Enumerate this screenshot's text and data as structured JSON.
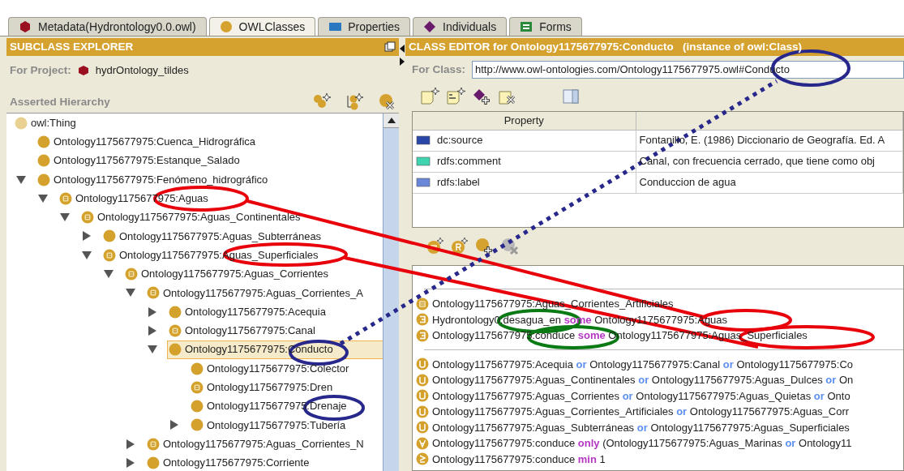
{
  "tabs": [
    {
      "label": "Metadata(Hydrontology0.0.owl)",
      "kind": "metadata",
      "selected": false
    },
    {
      "label": "OWLClasses",
      "kind": "classes",
      "selected": true
    },
    {
      "label": "Properties",
      "kind": "properties",
      "selected": false
    },
    {
      "label": "Individuals",
      "kind": "individuals",
      "selected": false
    },
    {
      "label": "Forms",
      "kind": "forms",
      "selected": false
    }
  ],
  "subclass_explorer": {
    "title": "SUBCLASS EXPLORER",
    "project_label": "For Project:",
    "project": "hydrOntology_tildes",
    "hierarchy_label": "Asserted Hierarchy",
    "tree": [
      {
        "label": "owl:Thing",
        "kind": "thing",
        "selected": false,
        "children": [
          {
            "label": "Ontology1175677975:Cuenca_Hidrográfica",
            "kind": "primitive",
            "selected": false
          },
          {
            "label": "Ontology1175677975:Estanque_Salado",
            "kind": "primitive",
            "selected": false
          },
          {
            "label": "Ontology1175677975:Fenómeno_hidrográfico",
            "kind": "primitive",
            "selected": false,
            "expanded": true,
            "children": [
              {
                "label": "Ontology1175677975:Aguas",
                "kind": "defined",
                "selected": false,
                "expanded": true,
                "children": [
                  {
                    "label": "Ontology1175677975:Aguas_Continentales",
                    "kind": "defined",
                    "selected": false,
                    "expanded": true,
                    "children": [
                      {
                        "label": "Ontology1175677975:Aguas_Subterráneas",
                        "kind": "primitive",
                        "selected": false,
                        "expanded": false
                      },
                      {
                        "label": "Ontology1175677975:Aguas_Superficiales",
                        "kind": "defined",
                        "selected": false,
                        "expanded": true,
                        "children": [
                          {
                            "label": "Ontology1175677975:Aguas_Corrientes",
                            "kind": "defined",
                            "selected": false,
                            "expanded": true,
                            "children": [
                              {
                                "label": "Ontology1175677975:Aguas_Corrientes_A",
                                "kind": "defined",
                                "selected": false,
                                "expanded": true,
                                "children": [
                                  {
                                    "label": "Ontology1175677975:Acequia",
                                    "kind": "primitive",
                                    "selected": false,
                                    "expanded": false
                                  },
                                  {
                                    "label": "Ontology1175677975:Canal",
                                    "kind": "defined",
                                    "selected": false,
                                    "expanded": false
                                  },
                                  {
                                    "label": "Ontology1175677975:Conducto",
                                    "kind": "primitive",
                                    "selected": true,
                                    "expanded": true,
                                    "children": [
                                      {
                                        "label": "Ontology1175677975:Colector",
                                        "kind": "primitive",
                                        "selected": false
                                      },
                                      {
                                        "label": "Ontology1175677975:Dren",
                                        "kind": "defined",
                                        "selected": false
                                      },
                                      {
                                        "label": "Ontology1175677975:Drenaje",
                                        "kind": "primitive",
                                        "selected": false
                                      },
                                      {
                                        "label": "Ontology1175677975:Tubería",
                                        "kind": "primitive",
                                        "selected": false,
                                        "expanded": false
                                      }
                                    ]
                                  }
                                ]
                              },
                              {
                                "label": "Ontology1175677975:Aguas_Corrientes_N",
                                "kind": "defined",
                                "selected": false,
                                "expanded": false
                              },
                              {
                                "label": "Ontology1175677975:Corriente",
                                "kind": "primitive",
                                "selected": false,
                                "expanded": false
                              }
                            ]
                          }
                        ]
                      }
                    ]
                  }
                ]
              }
            ]
          }
        ]
      }
    ]
  },
  "class_editor": {
    "title": "CLASS EDITOR for Ontology1175677975:Conducto   (instance of owl:Class)",
    "class_label": "For Class:",
    "class_uri": "http://www.owl-ontologies.com/Ontology1175677975.owl#Conducto",
    "table": {
      "columns": [
        "Property"
      ],
      "rows": [
        {
          "property": "dc:source",
          "value": "Fontanillo, E. (1986) Diccionario de Geografía. Ed. A",
          "color": "#2a46a8"
        },
        {
          "property": "rdfs:comment",
          "value": "Canal, con frecuencia cerrado, que tiene como obj",
          "color": "#3fd4b0"
        },
        {
          "property": "rdfs:label",
          "value": "Conduccion de agua",
          "color": "#6a86d8"
        }
      ]
    },
    "condition_groups": [
      {
        "rows": [
          {
            "kind": "named",
            "parts": [
              {
                "text": "Ontology1175677975:Aguas_Corrientes_Artificiales",
                "kind": "term"
              }
            ]
          },
          {
            "kind": "some",
            "parts": [
              {
                "text": "Hydrontology0:desagua_en",
                "kind": "term"
              },
              {
                "text": "some",
                "kind": "quantifier"
              },
              {
                "text": "Ontology1175677975:Aguas",
                "kind": "term"
              }
            ]
          },
          {
            "kind": "some",
            "parts": [
              {
                "text": "Ontology1175677975:conduce",
                "kind": "term"
              },
              {
                "text": "some",
                "kind": "quantifier"
              },
              {
                "text": "Ontology1175677975:Aguas_Superficiales",
                "kind": "term"
              }
            ]
          }
        ]
      },
      {
        "rows": [
          {
            "kind": "union",
            "parts": [
              {
                "text": "Ontology1175677975:Acequia",
                "kind": "term"
              },
              {
                "text": "or",
                "kind": "connective"
              },
              {
                "text": "Ontology1175677975:Canal",
                "kind": "term"
              },
              {
                "text": "or",
                "kind": "connective"
              },
              {
                "text": "Ontology1175677975:Co",
                "kind": "term"
              }
            ]
          },
          {
            "kind": "union",
            "parts": [
              {
                "text": "Ontology1175677975:Aguas_Continentales",
                "kind": "term"
              },
              {
                "text": "or",
                "kind": "connective"
              },
              {
                "text": "Ontology1175677975:Aguas_Dulces",
                "kind": "term"
              },
              {
                "text": "or",
                "kind": "connective"
              },
              {
                "text": "On",
                "kind": "term"
              }
            ]
          },
          {
            "kind": "union",
            "parts": [
              {
                "text": "Ontology1175677975:Aguas_Corrientes",
                "kind": "term"
              },
              {
                "text": "or",
                "kind": "connective"
              },
              {
                "text": "Ontology1175677975:Aguas_Quietas",
                "kind": "term"
              },
              {
                "text": "or",
                "kind": "connective"
              },
              {
                "text": "Onto",
                "kind": "term"
              }
            ]
          },
          {
            "kind": "union",
            "parts": [
              {
                "text": "Ontology1175677975:Aguas_Corrientes_Artificiales",
                "kind": "term"
              },
              {
                "text": "or",
                "kind": "connective"
              },
              {
                "text": "Ontology1175677975:Aguas_Corr",
                "kind": "term"
              }
            ]
          },
          {
            "kind": "union",
            "parts": [
              {
                "text": "Ontology1175677975:Aguas_Subterráneas",
                "kind": "term"
              },
              {
                "text": "or",
                "kind": "connective"
              },
              {
                "text": "Ontology1175677975:Aguas_Superficiales",
                "kind": "term"
              }
            ]
          },
          {
            "kind": "only",
            "parts": [
              {
                "text": "Ontology1175677975:conduce",
                "kind": "term"
              },
              {
                "text": "only",
                "kind": "quantifier"
              },
              {
                "text": "(Ontology1175677975:Aguas_Marinas",
                "kind": "term"
              },
              {
                "text": "or",
                "kind": "connective"
              },
              {
                "text": "Ontology11",
                "kind": "term"
              }
            ]
          },
          {
            "kind": "min",
            "parts": [
              {
                "text": "Ontology1175677975:conduce",
                "kind": "term"
              },
              {
                "text": "min",
                "kind": "quantifier"
              },
              {
                "text": "1",
                "kind": "term"
              }
            ]
          }
        ]
      }
    ]
  },
  "annotations": [
    {
      "kind": "ellipse",
      "color": "#e8000a"
    },
    {
      "kind": "ellipse",
      "color": "#e8000a"
    },
    {
      "kind": "ellipse",
      "color": "#e8000a"
    },
    {
      "kind": "ellipse",
      "color": "#e8000a"
    },
    {
      "kind": "line",
      "color": "#e8000a"
    },
    {
      "kind": "line",
      "color": "#e8000a"
    },
    {
      "kind": "ellipse",
      "color": "#28288c"
    },
    {
      "kind": "ellipse",
      "color": "#28288c"
    },
    {
      "kind": "ellipse",
      "color": "#28288c"
    },
    {
      "kind": "dotted-line",
      "color": "#28288c"
    },
    {
      "kind": "ellipse",
      "color": "#0a7a14"
    },
    {
      "kind": "ellipse",
      "color": "#0a7a14"
    }
  ]
}
